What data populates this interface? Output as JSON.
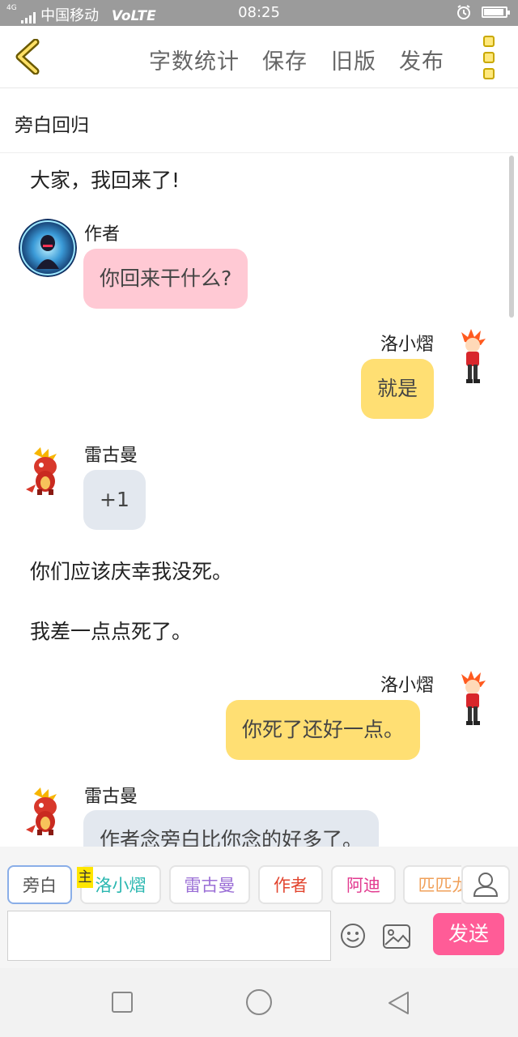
{
  "status_bar": {
    "network_tag": "4G",
    "carrier": "中国移动",
    "volte": "VoLTE",
    "time": "08:25",
    "battery_percent": 100
  },
  "toolbar": {
    "back_icon": "chevron-left-icon",
    "word_count": "字数统计",
    "save": "保存",
    "old_version": "旧版",
    "publish": "发布",
    "more_icon": "more-vertical-icon",
    "accent_color": "#e8c52a"
  },
  "chapter_title": "旁白回归",
  "messages": [
    {
      "type": "narration",
      "text": "大家，我回来了!"
    },
    {
      "type": "left",
      "name": "作者",
      "text": "你回来干什么?",
      "bubble_color": "#ffc9d4"
    },
    {
      "type": "right",
      "name": "洛小熠",
      "text": "就是",
      "bubble_color": "#ffdf73"
    },
    {
      "type": "left",
      "name": "雷古曼",
      "text": "+1",
      "bubble_color": "#e3e8ef"
    },
    {
      "type": "narration",
      "text": "你们应该庆幸我没死。"
    },
    {
      "type": "narration",
      "text": "我差一点点死了。"
    },
    {
      "type": "right",
      "name": "洛小熠",
      "text": "你死了还好一点。",
      "bubble_color": "#ffdf73"
    },
    {
      "type": "left",
      "name": "雷古曼",
      "text": "作者念旁白比你念的好多了。",
      "bubble_color": "#e3e8ef"
    }
  ],
  "composer": {
    "main_badge": "主",
    "characters": [
      {
        "label": "旁白",
        "color": "#555555"
      },
      {
        "label": "洛小熠",
        "color": "#2ab7b0"
      },
      {
        "label": "雷古曼",
        "color": "#9b6fd6"
      },
      {
        "label": "作者",
        "color": "#e2452f"
      },
      {
        "label": "阿迪",
        "color": "#e23a8f"
      },
      {
        "label": "匹匹龙",
        "color": "#f0a05a"
      }
    ],
    "input_value": "",
    "send": "发送",
    "send_color": "#ff5c97"
  }
}
